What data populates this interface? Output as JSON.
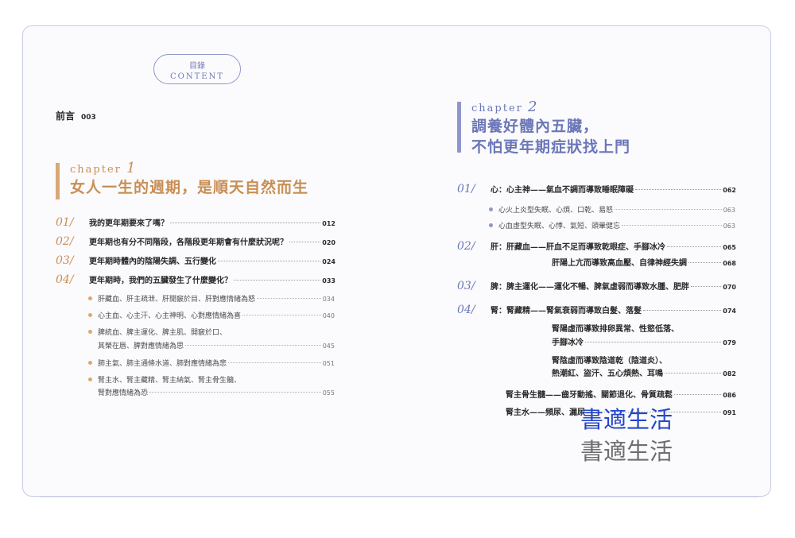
{
  "badge": {
    "zh": "目錄",
    "en": "CONTENT"
  },
  "preface": {
    "label": "前言",
    "page": "003"
  },
  "chapter1": {
    "label": "chapter",
    "num": "1",
    "title": "女人一生的週期，是順天自然而生",
    "items": [
      {
        "no": "01/",
        "text": "我的更年期要來了嗎？",
        "page": "012"
      },
      {
        "no": "02/",
        "text": "更年期也有分不同階段，各階段更年期會有什麼狀況呢？",
        "page": "020"
      },
      {
        "no": "03/",
        "text": "更年期時體內的陰陽失調、五行變化",
        "page": "024"
      },
      {
        "no": "04/",
        "text": "更年期時，我們的五臟發生了什麼變化？",
        "page": "033"
      }
    ],
    "subs": [
      {
        "text": "肝藏血、肝主疏泄、肝開竅於目、肝對應情緒為怒",
        "page": "034"
      },
      {
        "text": "心主血、心主汗、心主神明、心對應情緒為喜",
        "page": "040"
      },
      {
        "line1": "脾統血、脾主運化、脾主肌、開竅於口、",
        "line2": "其榮在唇、脾對應情緒為思",
        "page": "045"
      },
      {
        "text": "肺主氣、肺主通條水道、肺對應情緒為悲",
        "page": "051"
      },
      {
        "line1": "腎主水、腎主藏精、腎主納氣、腎主骨生髓、",
        "line2": "腎對應情緒為恐",
        "page": "055"
      }
    ]
  },
  "chapter2": {
    "label": "chapter",
    "num": "2",
    "title1": "調養好體內五臟，",
    "title2": "不怕更年期症狀找上門",
    "items": [
      {
        "no": "01/",
        "text": "心：心主神——氣血不調而導致睡眠障礙",
        "page": "062"
      },
      {
        "no": "02/",
        "text": "肝：肝藏血——肝血不足而導致乾眼症、手腳冰冷",
        "page": "065"
      },
      {
        "no": "03/",
        "text": "脾：脾主運化——運化不暢、脾氣虛弱而導致水腫、肥胖",
        "page": "070"
      },
      {
        "no": "04/",
        "text": "腎：腎藏精——腎氣衰弱而導致白髮、落髮",
        "page": "074"
      }
    ],
    "subs": [
      {
        "text": "心火上炎型失眠、心煩、口乾、易怒",
        "page": "063"
      },
      {
        "text": "心血虛型失眠、心悸、氣短、頭暈健忘",
        "page": "063"
      }
    ],
    "liver_extra": {
      "text": "肝陽上亢而導致高血壓、自律神經失調",
      "page": "068"
    },
    "kidney_extra": [
      {
        "line1": "腎陽虛而導致排卵異常、性慾低落、",
        "line2": "手腳冰冷",
        "page": "079"
      },
      {
        "line1": "腎陰虛而導致陰道乾（陰道炎）、",
        "line2": "熱潮紅、盜汗、五心煩熱、耳鳴",
        "page": "082"
      },
      {
        "text": "腎主骨生髓——齒牙動搖、關節退化、骨質疏鬆",
        "page": "086"
      },
      {
        "text": "腎主水——頻尿、漏尿",
        "page": "091"
      }
    ]
  },
  "watermark": {
    "line1": "書適生活",
    "line2": "書適生活"
  },
  "colors": {
    "gold": "#c98e54",
    "blue": "#6b77b8",
    "border": "#c7cbe6"
  }
}
